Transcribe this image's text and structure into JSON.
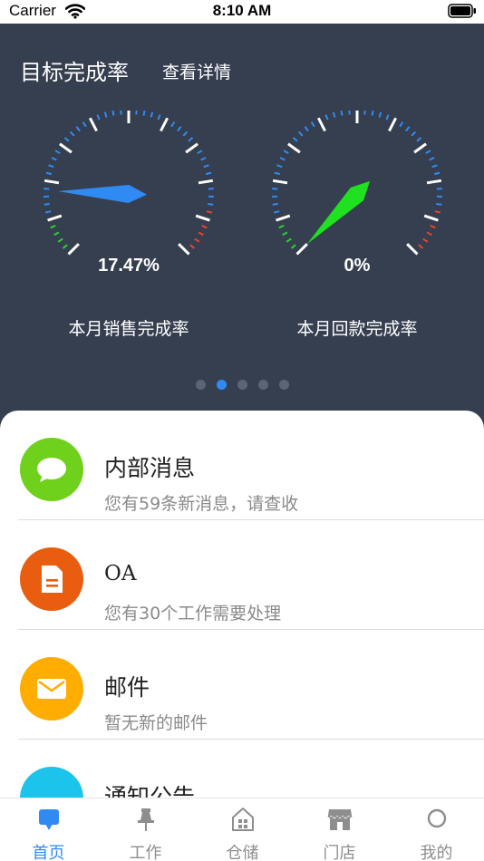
{
  "status_bar": {
    "carrier": "Carrier",
    "time": "8:10 AM"
  },
  "dashboard": {
    "title": "目标完成率",
    "detail_link": "查看详情",
    "gauges": [
      {
        "value_text": "17.47%",
        "fraction": 0.1747,
        "label": "本月销售完成率",
        "needle_color": "#2f8bf3"
      },
      {
        "value_text": "0%",
        "fraction": 0.0,
        "label": "本月回款完成率",
        "needle_color": "#1fe11f"
      }
    ],
    "pager": {
      "count": 5,
      "active_index": 1
    }
  },
  "list": {
    "items": [
      {
        "title": "内部消息",
        "subtitle": "您有59条新消息，请查收",
        "icon": "chat-bubble-icon",
        "color": "#6fd11c"
      },
      {
        "title": "OA",
        "subtitle": "您有30个工作需要处理",
        "icon": "document-icon",
        "color": "#e85d10"
      },
      {
        "title": "邮件",
        "subtitle": "暂无新的邮件",
        "icon": "envelope-icon",
        "color": "#ffad00"
      },
      {
        "title": "通知公告",
        "subtitle": "",
        "icon": "notice-icon",
        "color": "#1cc3ea"
      }
    ]
  },
  "tabbar": {
    "active": 0,
    "accent": "#2f8bf3",
    "tabs": [
      {
        "label": "首页",
        "icon": "home-chat-icon"
      },
      {
        "label": "工作",
        "icon": "pin-icon"
      },
      {
        "label": "仓储",
        "icon": "warehouse-icon"
      },
      {
        "label": "门店",
        "icon": "store-icon"
      },
      {
        "label": "我的",
        "icon": "profile-circle-icon"
      }
    ]
  }
}
